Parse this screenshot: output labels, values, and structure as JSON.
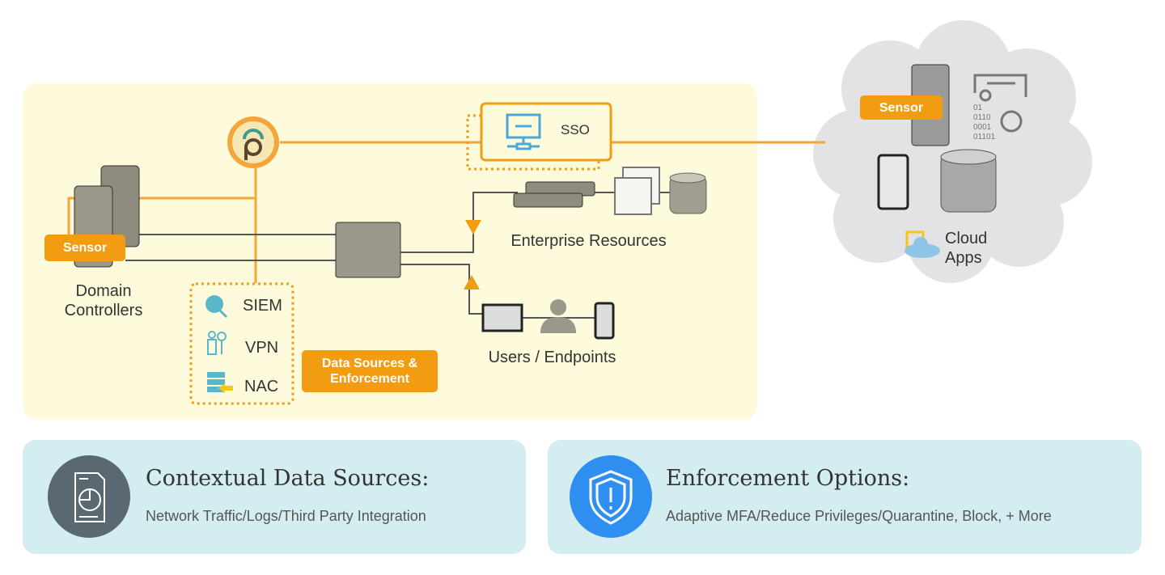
{
  "colors": {
    "accent": "#f29c11",
    "panel": "#fdfbdc",
    "card": "#d3edf1",
    "cloud": "#e3e3e5",
    "data_icon_bg": "#5a6872",
    "shield_icon_bg": "#2f8ff0"
  },
  "diagram": {
    "sensor_label": "Sensor",
    "domain_controllers": [
      "Domain",
      "Controllers"
    ],
    "sso_label": "SSO",
    "enterprise_resources": "Enterprise Resources",
    "users_endpoints": "Users / Endpoints",
    "data_sources": [
      {
        "label": "SIEM",
        "icon": "search-chart-icon"
      },
      {
        "label": "VPN",
        "icon": "user-key-icon"
      },
      {
        "label": "NAC",
        "icon": "server-arrow-icon"
      }
    ],
    "data_sources_badge": [
      "Data Sources &",
      "Enforcement"
    ],
    "cloud": {
      "sensor_label": "Sensor",
      "binary": [
        "01",
        "0110",
        "0001",
        "01101"
      ],
      "label": [
        "Cloud",
        "Apps"
      ]
    }
  },
  "cards": [
    {
      "title": "Contextual Data Sources:",
      "subtitle": "Network Traffic/Logs/Third Party Integration",
      "icon": "document-pie-chart-icon"
    },
    {
      "title": "Enforcement Options:",
      "subtitle": "Adaptive MFA/Reduce Privileges/Quarantine, Block, + More",
      "icon": "shield-alert-icon"
    }
  ]
}
